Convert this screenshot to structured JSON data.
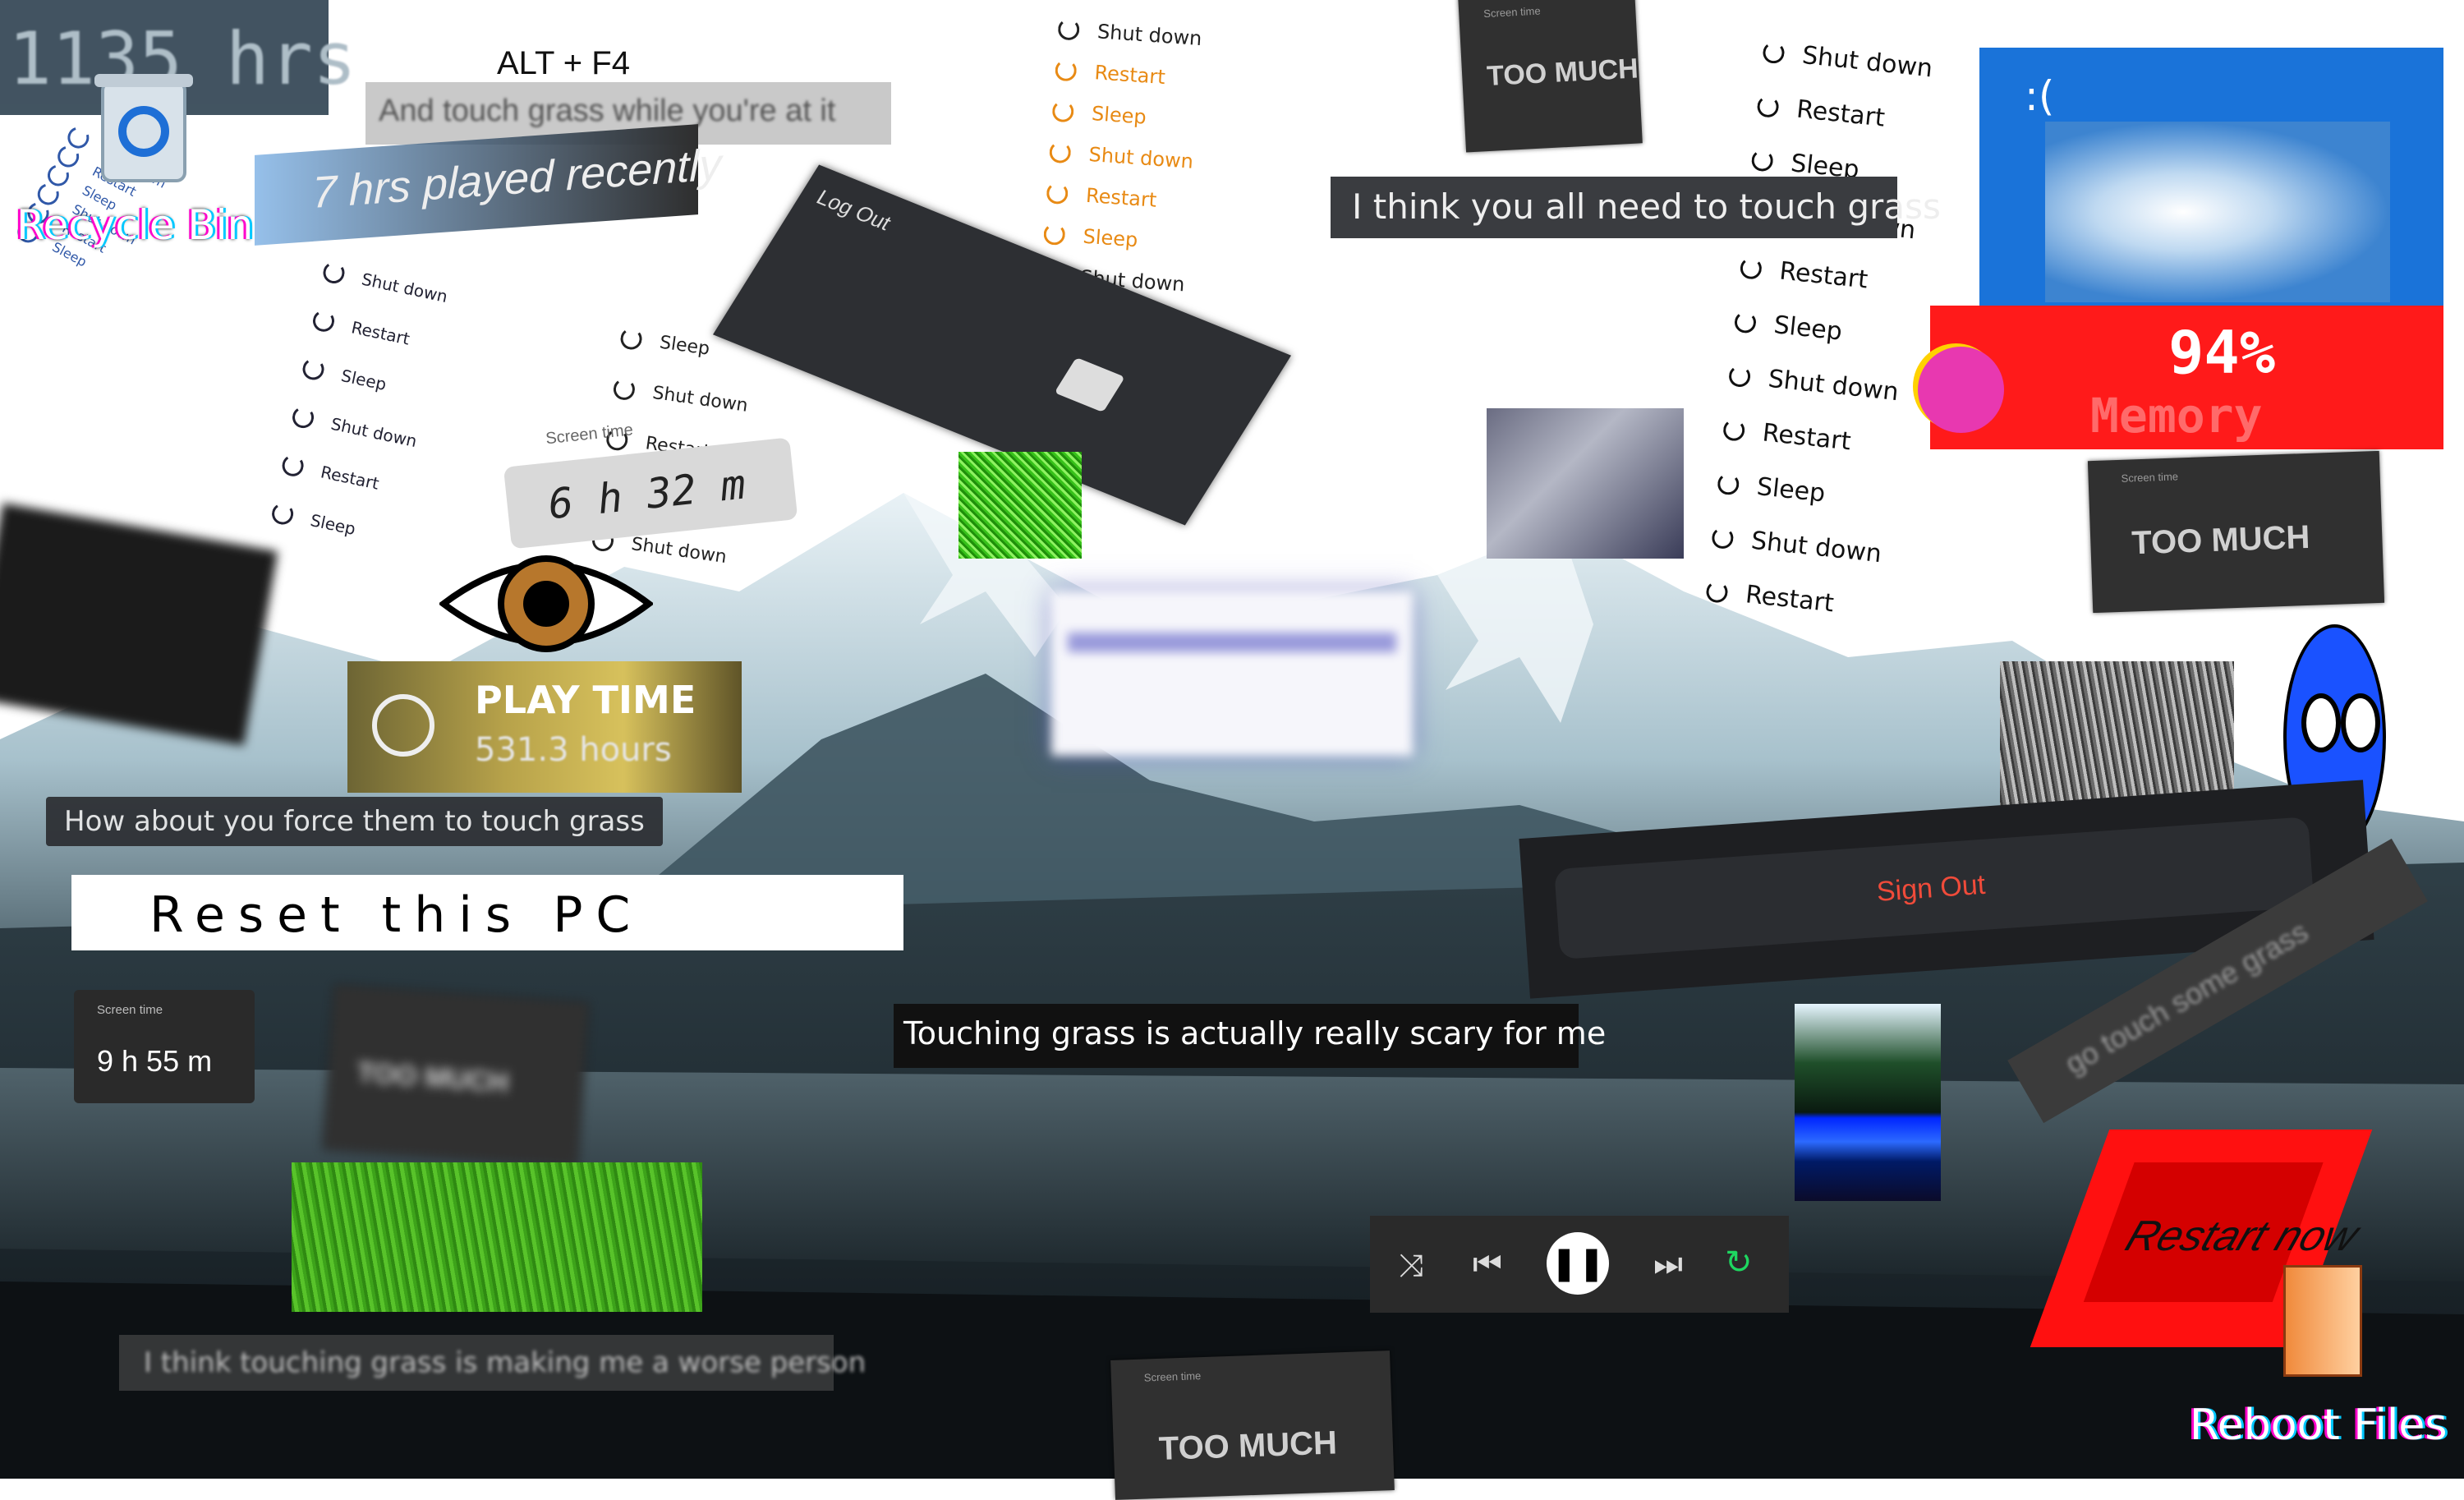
{
  "desktop": {
    "recycle_bin_label": "Recycle Bin",
    "hours_counter": "1135 hrs",
    "hours_played_recently": "7 hrs played recently",
    "alt_f4": "ALT + F4",
    "touch_grass_while": "And touch grass while you're at it",
    "screen_time_label_1": "Screen time",
    "screen_time_value_1": "6 h 32 m",
    "screen_time_label_2": "Screen time",
    "screen_time_value_2": "9 h 55 m",
    "too_much_label": "Screen time",
    "too_much_text": "TOO MUCH",
    "log_out": "Log Out",
    "play_time_title": "PLAY TIME",
    "play_time_value": "531.3 hours",
    "msg_force_touch_grass": "How about you force them to touch grass",
    "reset_pc": "Reset this PC",
    "msg_all_need": "I think you all need to touch grass",
    "msg_scary": "Touching grass is actually really scary for me",
    "msg_worse_person": "I think touching grass is making me a worse person",
    "sign_out": "Sign Out",
    "go_touch": "go touch some grass",
    "memory_percent": "94%",
    "memory_label": "Memory",
    "restart_now": "Restart now",
    "reboot_files": "Reboot Files",
    "bsod_face": ":("
  },
  "power_menu": {
    "shut_down": "Shut down",
    "restart": "Restart",
    "sleep": "Sleep"
  },
  "media_controls": [
    "shuffle-icon",
    "previous-icon",
    "pause-icon",
    "next-icon",
    "repeat-icon"
  ],
  "colors": {
    "bsod_blue": "#1a73d9",
    "memory_red": "#ff1a1a",
    "grass_green": "#4fbf1f",
    "orange_menu": "#e88a14",
    "dark_panel": "#2b2d31",
    "restart_red": "#ff1010"
  }
}
